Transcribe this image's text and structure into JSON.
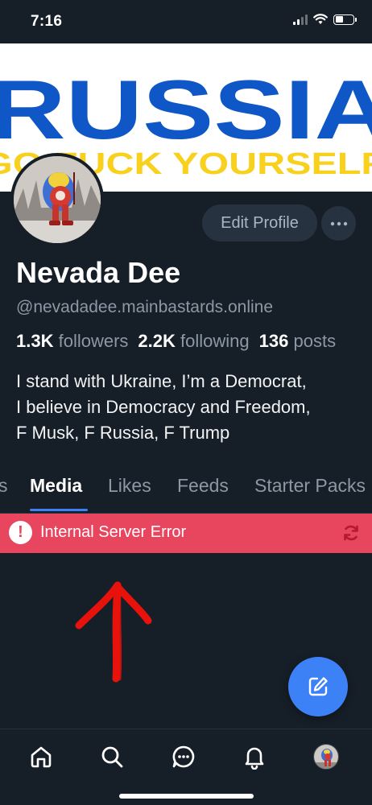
{
  "status_bar": {
    "time": "7:16"
  },
  "banner": {
    "line1": "RUSSIA",
    "line2": "GO FUCK YOURSELF"
  },
  "profile": {
    "edit_label": "Edit Profile",
    "more_label": "···",
    "display_name": "Nevada Dee",
    "handle": "@nevadadee.mainbastards.online",
    "followers_count": "1.3K",
    "followers_label": "followers",
    "following_count": "2.2K",
    "following_label": "following",
    "posts_count": "136",
    "posts_label": "posts",
    "bio": [
      "I stand with Ukraine, I’m a Democrat,",
      "I believe in Democracy and Freedom,",
      "F Musk, F Russia, F Trump"
    ]
  },
  "tabs": [
    {
      "label": "s"
    },
    {
      "label": "Media",
      "active": true
    },
    {
      "label": "Likes"
    },
    {
      "label": "Feeds"
    },
    {
      "label": "Starter Packs"
    }
  ],
  "error": {
    "message": "Internal Server Error",
    "icon": "!"
  },
  "icons": {
    "home": "home-icon",
    "search": "search-icon",
    "messages": "chat-icon",
    "notifications": "bell-icon",
    "compose": "compose-icon",
    "retry": "retry-icon"
  },
  "colors": {
    "background": "#161e27",
    "accent": "#3c82f6",
    "error": "#e8455f",
    "banner_blue": "#0f57c7",
    "banner_yellow": "#f7d11e",
    "annotation_red": "#e8120c"
  }
}
